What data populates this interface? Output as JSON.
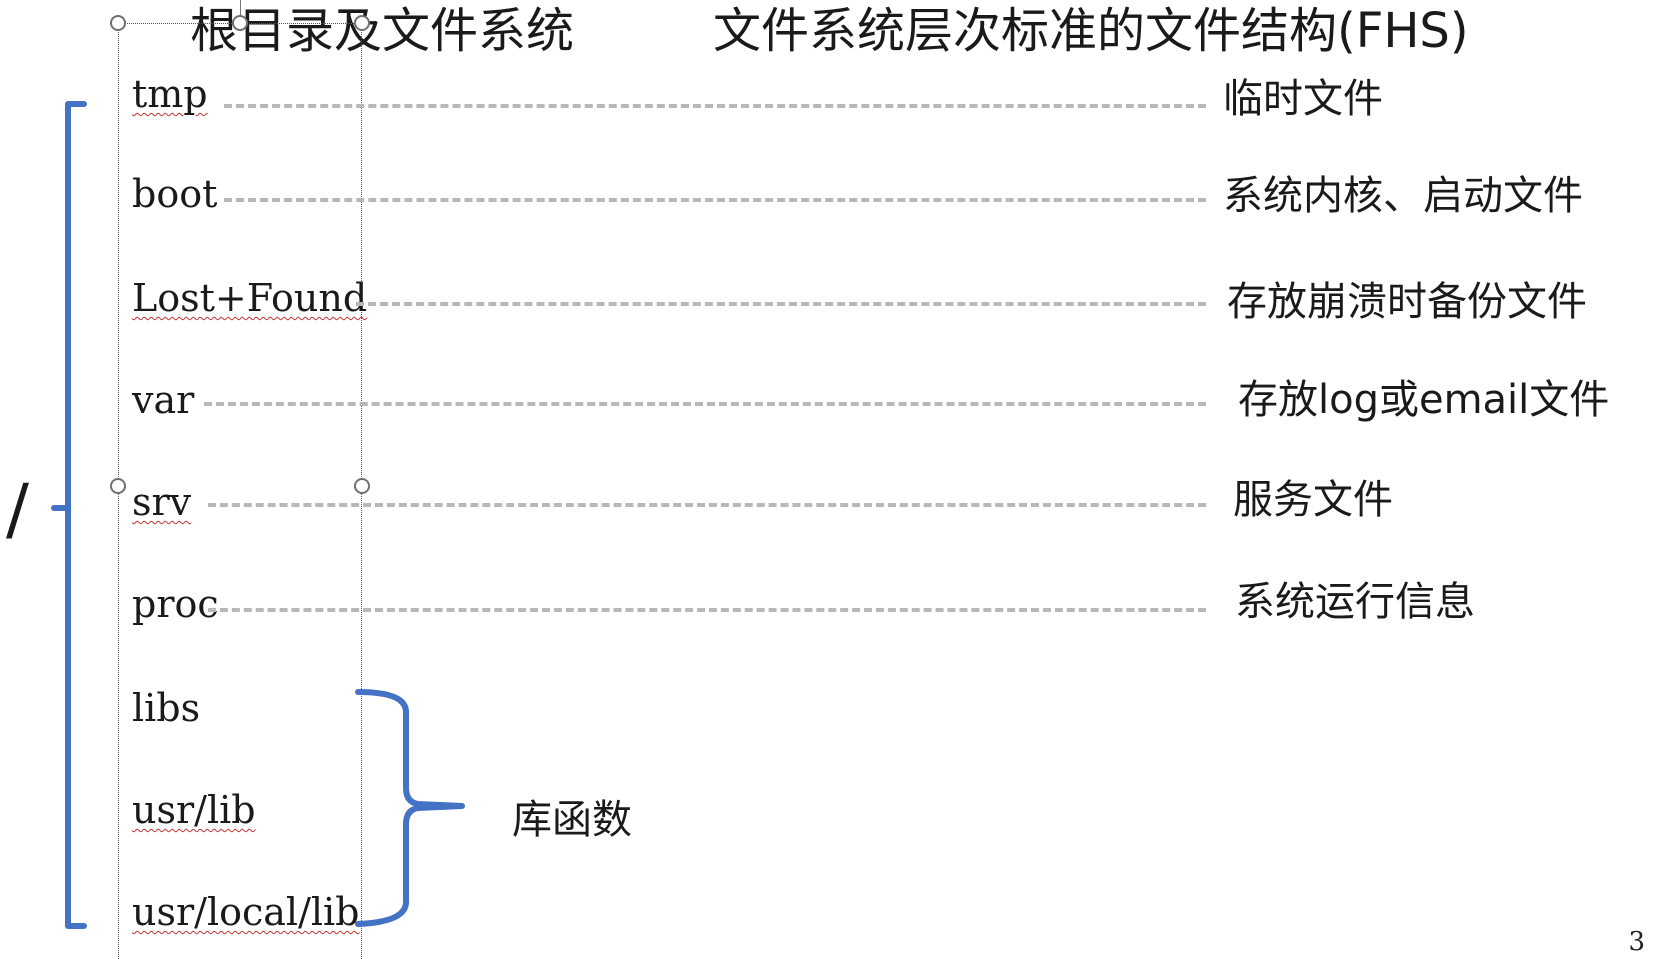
{
  "titles": {
    "left": "根目录及文件系统",
    "right": "文件系统层次标准的文件结构(FHS)"
  },
  "root_symbol": "/",
  "directories": [
    {
      "name": "tmp",
      "description": "临时文件"
    },
    {
      "name": "boot",
      "description": "系统内核、启动文件"
    },
    {
      "name": "Lost+Found",
      "description": "存放崩溃时备份文件"
    },
    {
      "name": "var",
      "description": "存放log或email文件"
    },
    {
      "name": "srv",
      "description": "服务文件"
    },
    {
      "name": "proc",
      "description": "系统运行信息"
    },
    {
      "name": "libs"
    },
    {
      "name": "usr/lib"
    },
    {
      "name": "usr/local/lib"
    }
  ],
  "library_group_label": "库函数",
  "page_number": "3",
  "colors": {
    "brace": "#4472c4",
    "dash": "#b8b8b8",
    "text": "#1a1a1a",
    "spellcheck": "#c23434"
  }
}
